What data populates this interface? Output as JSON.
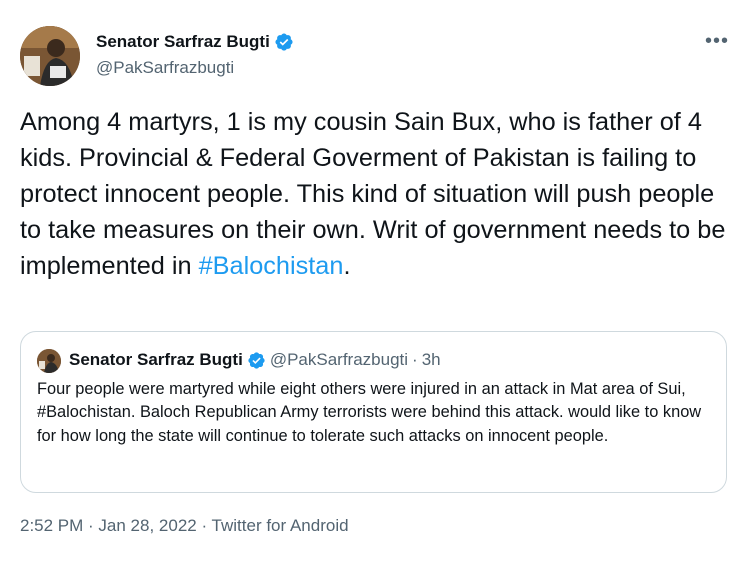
{
  "author": {
    "name": "Senator Sarfraz Bugti",
    "handle": "@PakSarfrazbugti"
  },
  "more_menu_label": "•••",
  "tweet": {
    "text_before_hashtag": "Among 4 martyrs, 1 is my cousin Sain Bux, who is father of 4 kids. Provincial & Federal Goverment of Pakistan is failing to protect innocent people. This kind of situation will push people to take measures on their own. Writ of government needs to be implemented in ",
    "hashtag": "#Balochistan",
    "text_after_hashtag": "."
  },
  "quoted_tweet": {
    "name": "Senator Sarfraz Bugti",
    "handle": "@PakSarfrazbugti",
    "separator": "·",
    "time": "3h",
    "text": "Four people were martyred while eight others were injured in an attack in Mat area of Sui, #Balochistan. Baloch Republican Army terrorists were behind this attack. would like to know for how long the state will continue to tolerate such attacks on innocent people."
  },
  "meta": {
    "time": "2:52 PM",
    "sep1": " · ",
    "date": "Jan 28, 2022",
    "sep2": " · ",
    "source": "Twitter for Android"
  },
  "colors": {
    "accent": "#1d9bf0",
    "text": "#0f1419",
    "secondary": "#536471",
    "border": "#cfd9de"
  }
}
